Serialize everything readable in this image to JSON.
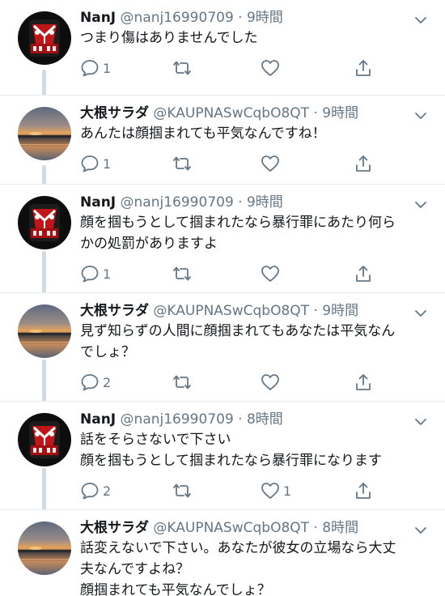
{
  "tweets": [
    {
      "name": "NanJ",
      "handle": "@nanj16990709",
      "dot": "·",
      "time": "9時間",
      "avatar": "nanj-avatar",
      "lines": [
        "つまり傷はありませんでした"
      ],
      "replies": "1",
      "likes": ""
    },
    {
      "name": "大根サラダ",
      "handle": "@KAUPNASwCqbO8QT",
      "dot": "·",
      "time": "9時間",
      "avatar": "sunset-avatar",
      "lines": [
        "あんたは顔掴まれても平気なんですね！"
      ],
      "replies": "1",
      "likes": ""
    },
    {
      "name": "NanJ",
      "handle": "@nanj16990709",
      "dot": "·",
      "time": "9時間",
      "avatar": "nanj-avatar",
      "lines": [
        "顔を掴もうとして掴まれたなら暴行罪にあたり何ら",
        "かの処罰がありますよ"
      ],
      "replies": "1",
      "likes": ""
    },
    {
      "name": "大根サラダ",
      "handle": "@KAUPNASwCqbO8QT",
      "dot": "·",
      "time": "9時間",
      "avatar": "sunset-avatar",
      "lines": [
        "見ず知らずの人間に顔掴まれてもあなたは平気なん",
        "でしょ？"
      ],
      "replies": "2",
      "likes": ""
    },
    {
      "name": "NanJ",
      "handle": "@nanj16990709",
      "dot": "·",
      "time": "8時間",
      "avatar": "nanj-avatar",
      "lines": [
        "話をそらさないで下さい",
        "顔を掴もうとして掴まれたなら暴行罪になります"
      ],
      "replies": "2",
      "likes": "1"
    },
    {
      "name": "大根サラダ",
      "handle": "@KAUPNASwCqbO8QT",
      "dot": "·",
      "time": "8時間",
      "avatar": "sunset-avatar",
      "lines": [
        "話変えないで下さい。あなたが彼女の立場なら大丈",
        "夫なんですよね？",
        "顔掴まれても平気なんでしょ？"
      ],
      "replies": "",
      "likes": ""
    }
  ],
  "icons": {
    "reply": "reply-icon",
    "retweet": "retweet-icon",
    "like": "heart-icon",
    "share": "share-icon",
    "more": "chevron-down-icon"
  },
  "colors": {
    "text": "#14171a",
    "secondary": "#657786",
    "thread_line": "#d4dbe0",
    "divider": "#e6ecf0"
  }
}
